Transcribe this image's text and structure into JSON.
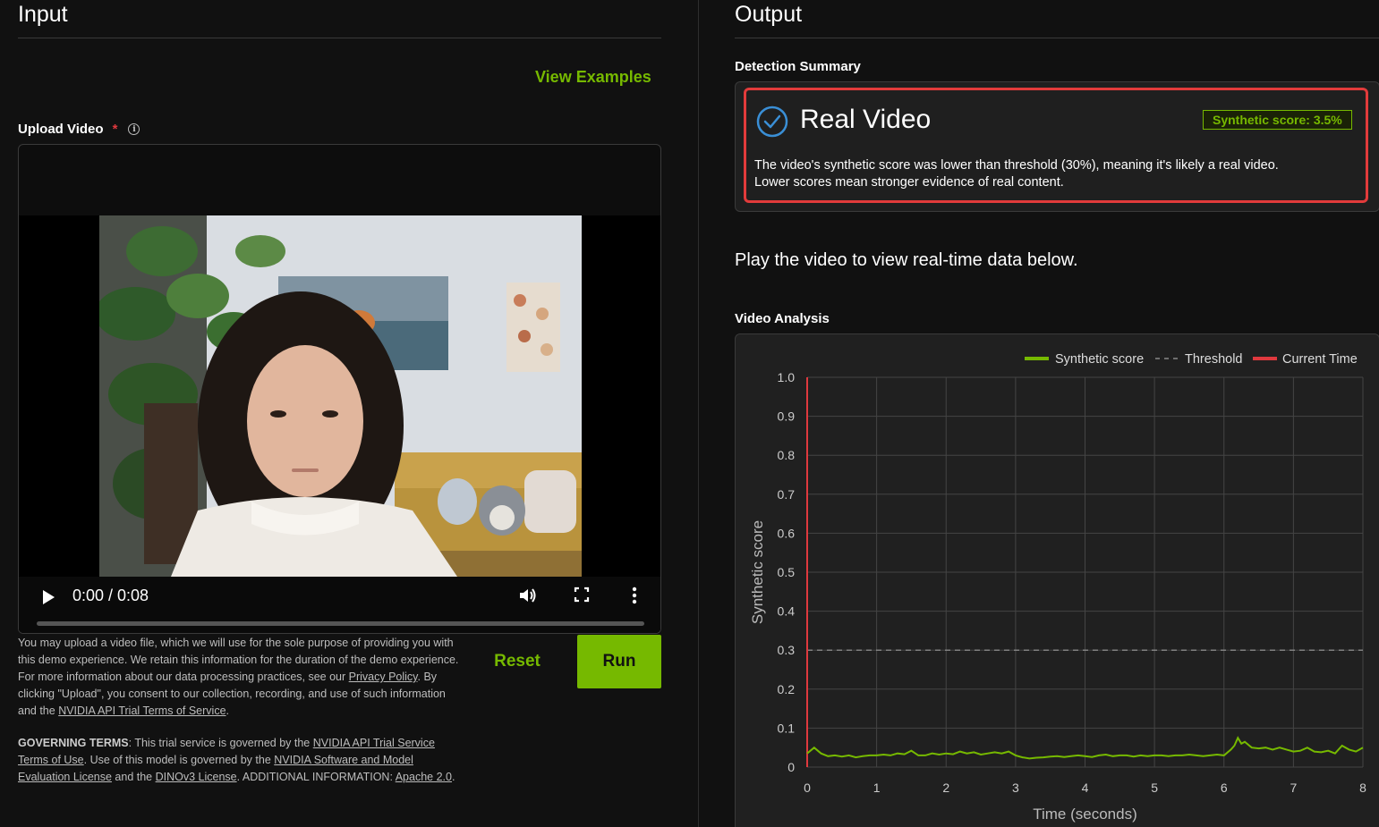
{
  "input": {
    "title": "Input",
    "view_examples": "View Examples",
    "upload_label": "Upload Video",
    "required_mark": "*",
    "info_glyph": "i",
    "video": {
      "time": "0:00 / 0:08",
      "progress": 0
    },
    "disclaimer": {
      "part1": "You may upload a video file, which we will use for the sole purpose of providing you with this demo experience. We retain this information for the duration of the demo experience. For more information about our data processing practices, see our ",
      "privacy_link": "Privacy Policy",
      "part2": ". By clicking \"Upload\", you consent to our collection, recording, and use of such information and the ",
      "terms_link": "NVIDIA API Trial Terms of Service",
      "part3": "."
    },
    "governing": {
      "label": "GOVERNING TERMS",
      "part1": ": This trial service is governed by the ",
      "link1": "NVIDIA API Trial Service Terms of Use",
      "part2": ". Use of this model is governed by the ",
      "link2": "NVIDIA Software and Model Evaluation License",
      "part3": " and the ",
      "link3": "DINOv3 License",
      "part4": ". ADDITIONAL INFORMATION: ",
      "link4": "Apache 2.0",
      "part5": "."
    },
    "reset_label": "Reset",
    "run_label": "Run"
  },
  "output": {
    "title": "Output",
    "detection_summary_label": "Detection Summary",
    "result_title": "Real Video",
    "score_badge": "Synthetic score: 3.5%",
    "description_line1": "The video's synthetic score was lower than threshold (30%), meaning it's likely a real video.",
    "description_line2": "Lower scores mean stronger evidence of real content.",
    "play_note": "Play the video to view real-time data below.",
    "video_analysis_label": "Video Analysis"
  },
  "colors": {
    "accent": "#76b900",
    "highlight": "#e23b3b",
    "check": "#3a8fd6"
  },
  "chart_data": {
    "type": "line",
    "xlabel": "Time (seconds)",
    "ylabel": "Synthetic score",
    "xlim": [
      0,
      8
    ],
    "ylim": [
      0,
      1
    ],
    "x_ticks": [
      "0",
      "1",
      "2",
      "3",
      "4",
      "5",
      "6",
      "7",
      "8"
    ],
    "y_ticks": [
      "0",
      "0.1",
      "0.2",
      "0.3",
      "0.4",
      "0.5",
      "0.6",
      "0.7",
      "0.8",
      "0.9",
      "1.0"
    ],
    "grid": true,
    "legend_position": "top-right",
    "legend": [
      "Synthetic score",
      "Threshold",
      "Current Time"
    ],
    "threshold": 0.3,
    "current_time": 0,
    "series": [
      {
        "name": "Synthetic score",
        "color": "#76b900",
        "x": [
          0,
          0.1,
          0.2,
          0.3,
          0.4,
          0.5,
          0.6,
          0.7,
          0.8,
          0.9,
          1.0,
          1.1,
          1.2,
          1.3,
          1.4,
          1.5,
          1.6,
          1.7,
          1.8,
          1.9,
          2.0,
          2.1,
          2.2,
          2.3,
          2.4,
          2.5,
          2.6,
          2.7,
          2.8,
          2.9,
          3.0,
          3.1,
          3.2,
          3.3,
          3.4,
          3.5,
          3.6,
          3.7,
          3.8,
          3.9,
          4.0,
          4.1,
          4.2,
          4.3,
          4.4,
          4.5,
          4.6,
          4.7,
          4.8,
          4.9,
          5.0,
          5.1,
          5.2,
          5.3,
          5.4,
          5.5,
          5.6,
          5.7,
          5.8,
          5.9,
          6.0,
          6.1,
          6.15,
          6.2,
          6.25,
          6.3,
          6.4,
          6.5,
          6.6,
          6.7,
          6.8,
          6.9,
          7.0,
          7.1,
          7.2,
          7.3,
          7.4,
          7.5,
          7.6,
          7.7,
          7.8,
          7.9,
          8.0
        ],
        "y": [
          0.035,
          0.05,
          0.035,
          0.028,
          0.03,
          0.027,
          0.03,
          0.025,
          0.028,
          0.03,
          0.03,
          0.032,
          0.03,
          0.035,
          0.033,
          0.042,
          0.03,
          0.03,
          0.035,
          0.032,
          0.035,
          0.033,
          0.04,
          0.035,
          0.038,
          0.032,
          0.035,
          0.038,
          0.035,
          0.04,
          0.03,
          0.025,
          0.022,
          0.024,
          0.025,
          0.027,
          0.028,
          0.026,
          0.028,
          0.03,
          0.028,
          0.026,
          0.03,
          0.032,
          0.028,
          0.03,
          0.03,
          0.027,
          0.03,
          0.028,
          0.03,
          0.03,
          0.028,
          0.03,
          0.03,
          0.032,
          0.03,
          0.028,
          0.03,
          0.032,
          0.03,
          0.045,
          0.055,
          0.075,
          0.06,
          0.065,
          0.05,
          0.048,
          0.05,
          0.045,
          0.05,
          0.045,
          0.04,
          0.042,
          0.05,
          0.04,
          0.038,
          0.042,
          0.035,
          0.055,
          0.045,
          0.04,
          0.05
        ]
      }
    ]
  }
}
